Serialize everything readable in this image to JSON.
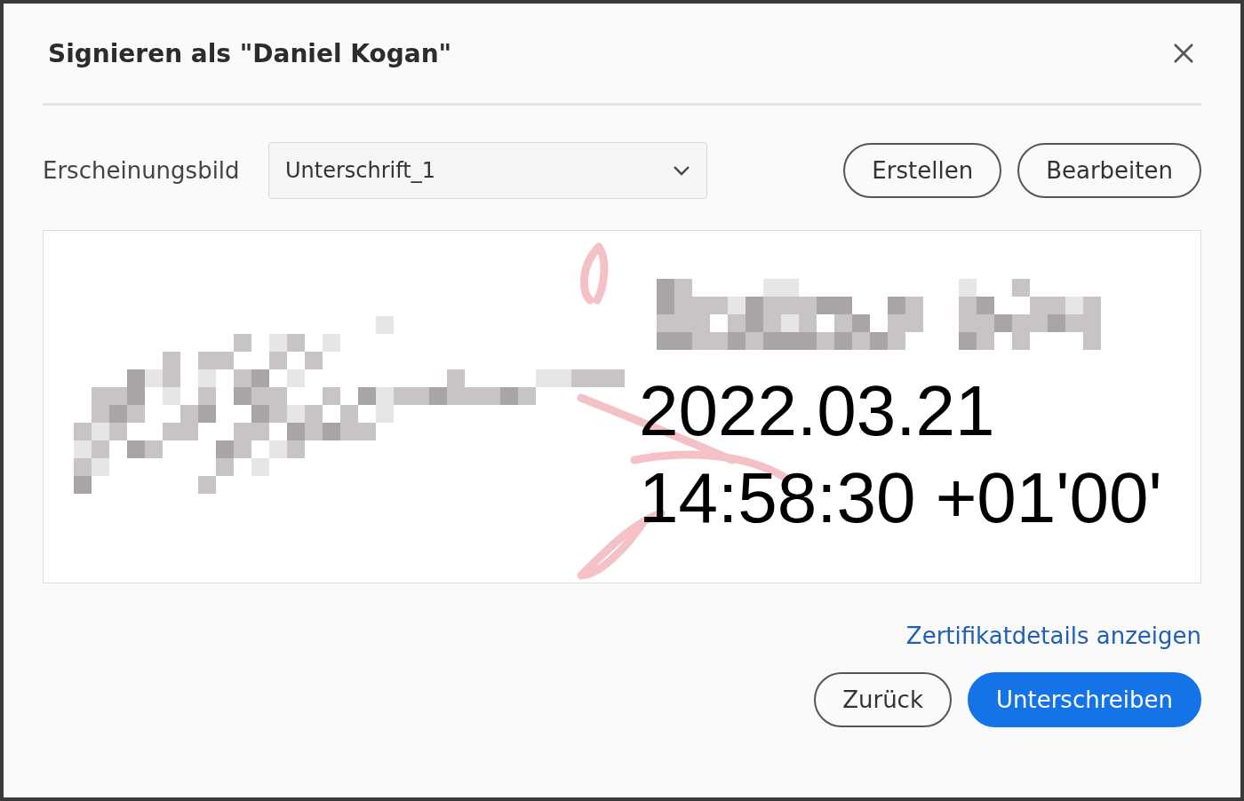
{
  "dialog": {
    "title": "Signieren als \"Daniel Kogan\""
  },
  "appearance": {
    "label": "Erscheinungsbild",
    "value": "Unterschrift_1"
  },
  "actions": [
    "Erstellen",
    "Bearbeiten"
  ],
  "preview": {
    "date": "2022.03.21",
    "time": "14:58:30 +01'00'"
  },
  "link": "Zertifikatdetails anzeigen",
  "buttons": [
    {
      "label": "Zurück",
      "kind": "secondary"
    },
    {
      "label": "Unterschreiben",
      "kind": "primary"
    }
  ]
}
